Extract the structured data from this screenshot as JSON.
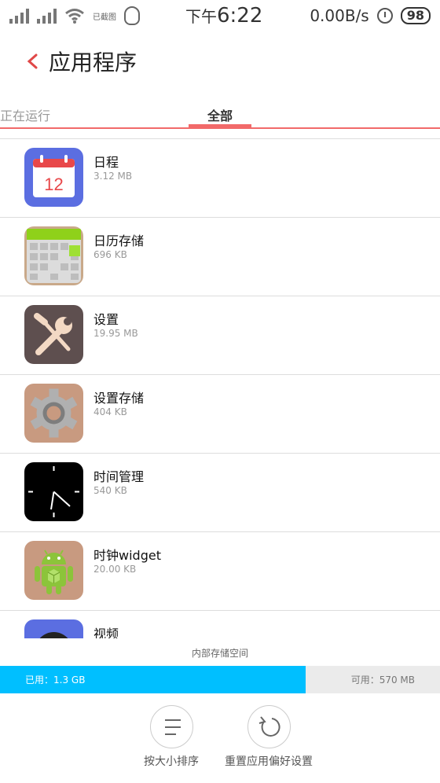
{
  "status_bar": {
    "screenshot_label": "已截图",
    "time_prefix": "下午",
    "time": "6:22",
    "net_speed": "0.00B/s",
    "battery": "98"
  },
  "header": {
    "title": "应用程序"
  },
  "tabs": [
    {
      "label": "正在运行",
      "active": false
    },
    {
      "label": "全部",
      "active": true
    }
  ],
  "apps": [
    {
      "name": "日程",
      "size": "3.12 MB",
      "icon": "calendar-icon",
      "icon_text": "12"
    },
    {
      "name": "日历存储",
      "size": "696 KB",
      "icon": "calendar-storage-icon"
    },
    {
      "name": "设置",
      "size": "19.95 MB",
      "icon": "wrench-icon"
    },
    {
      "name": "设置存储",
      "size": "404 KB",
      "icon": "gear-icon"
    },
    {
      "name": "时间管理",
      "size": "540 KB",
      "icon": "clock-icon"
    },
    {
      "name": "时钟widget",
      "size": "20.00 KB",
      "icon": "android-icon"
    },
    {
      "name": "视频",
      "size": "",
      "icon": "video-icon"
    }
  ],
  "storage": {
    "label": "内部存储空间",
    "used": "已用：1.3 GB",
    "available": "可用：570 MB",
    "used_fraction": 0.695
  },
  "actions": {
    "sort_by_size": "按大小排序",
    "reset_preferences": "重置应用偏好设置"
  }
}
